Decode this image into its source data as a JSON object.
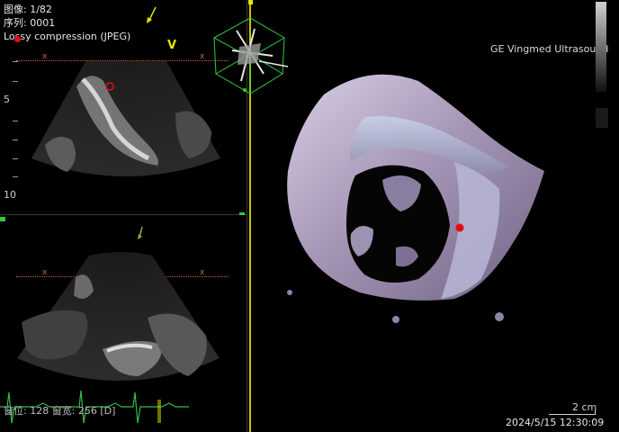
{
  "overlay": {
    "image_label": "图像: 1/82",
    "series_label": "序列: 0001",
    "compression_label": "Lossy compression (JPEG)",
    "vendor_label": "GE Vingmed Ultrasound",
    "window_label": "窗位: 128 窗宽: 256 [D]",
    "timestamp": "2024/5/15 12:30:09",
    "scale_label": "2 cm"
  },
  "left_view": {
    "top_marker": "V",
    "depth_5": "5",
    "depth_10": "10",
    "x_mark": "x"
  },
  "colors": {
    "overlay_text": "#e6e6e6",
    "marker_yellow": "#e6e600",
    "marker_green": "#2ecc40",
    "ecg_green": "#2fbf4a",
    "red_dot": "#e01010",
    "tissue": "#b9aec8"
  },
  "icons": {
    "orientation_cube": "3d-orientation-cube-icon",
    "arrow": "down-arrow-icon"
  }
}
